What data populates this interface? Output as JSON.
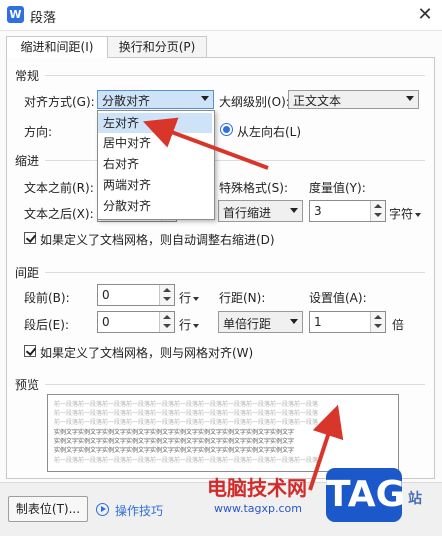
{
  "window": {
    "title": "段落",
    "app_icon": "W",
    "close_glyph": "✕"
  },
  "tabs": [
    {
      "label": "缩进和间距(I)",
      "active": true
    },
    {
      "label": "换行和分页(P)",
      "active": false
    }
  ],
  "general": {
    "section": "常规",
    "align_label": "对齐方式(G):",
    "align_value": "分散对齐",
    "outline_label": "大纲级别(O):",
    "outline_value": "正文文本",
    "direction_label": "方向:",
    "direction_option": "从左向右(L)"
  },
  "align_dropdown": {
    "options": [
      "左对齐",
      "居中对齐",
      "右对齐",
      "两端对齐",
      "分散对齐"
    ],
    "highlighted": "左对齐"
  },
  "indent": {
    "section": "缩进",
    "before_label": "文本之前(R):",
    "after_label": "文本之后(X):",
    "special_label": "特殊格式(S):",
    "special_value": "首行缩进",
    "measure_label": "度量值(Y):",
    "measure_value": "3",
    "measure_unit": "字符",
    "grid_checkbox": "如果定义了文档网格，则自动调整右缩进(D)"
  },
  "spacing": {
    "section": "间距",
    "before_label": "段前(B):",
    "before_value": "0",
    "before_unit": "行",
    "after_label": "段后(E):",
    "after_value": "0",
    "after_unit": "行",
    "line_label": "行距(N):",
    "line_value": "单倍行距",
    "set_label": "设置值(A):",
    "set_value": "1",
    "set_unit": "倍",
    "grid_checkbox": "如果定义了文档网格，则与网格对齐(W)"
  },
  "preview": {
    "section": "预览",
    "gray_line": "前一段落前一段落前一段落前一段落前一段落前一段落前一段落前一段落前一段落前一段落前一段落",
    "dark_line": "实例文字实例文字实例文字实例文字实例文字实例文字实例文字实例文字实例文字实例文字"
  },
  "footer": {
    "tab_stops_button": "制表位(T)...",
    "tips_link": "操作技巧"
  },
  "watermark": {
    "cn_text": "电脑技术网",
    "url": "www.tagxp.com",
    "logo": "TAG",
    "site_suffix": "站"
  },
  "colors": {
    "accent": "#2f6fe0",
    "arrow_red": "#d9362b",
    "highlight": "#cfe3f8"
  }
}
